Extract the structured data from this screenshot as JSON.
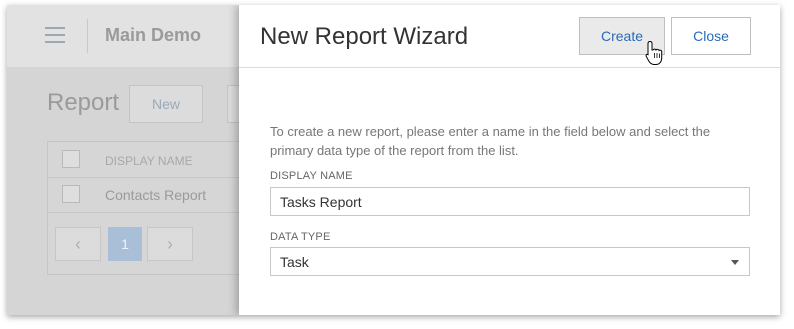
{
  "app": {
    "title": "Main Demo",
    "page_title": "Report",
    "new_button": "New",
    "grid": {
      "header": "DISPLAY NAME",
      "rows": [
        "Contacts Report"
      ]
    },
    "pager": {
      "current_page": "1",
      "prev": "‹",
      "next": "›"
    }
  },
  "dialog": {
    "title": "New Report Wizard",
    "create_label": "Create",
    "close_label": "Close",
    "description": "To create a new report, please enter a name in the field below and select the primary data type of the report from the list.",
    "display_name_label": "DISPLAY NAME",
    "display_name_value": "Tasks Report",
    "data_type_label": "DATA TYPE",
    "data_type_value": "Task"
  },
  "colors": {
    "accent": "#2a6bb5",
    "pager_active": "#a9bfd7"
  }
}
